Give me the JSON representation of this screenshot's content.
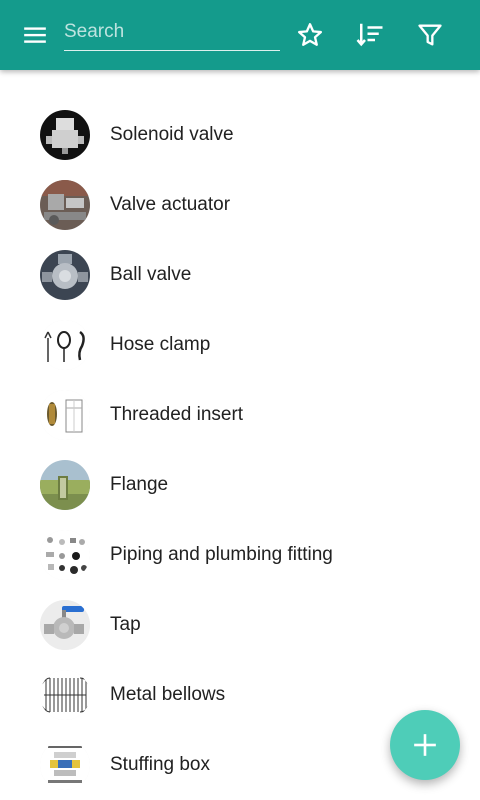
{
  "appbar": {
    "search": {
      "placeholder": "Search",
      "value": ""
    },
    "background_color": "#149b8c",
    "icons": [
      "menu-icon",
      "star-icon",
      "sort-icon",
      "filter-icon"
    ]
  },
  "items": [
    {
      "label": "Solenoid valve"
    },
    {
      "label": "Valve actuator"
    },
    {
      "label": "Ball valve"
    },
    {
      "label": "Hose clamp"
    },
    {
      "label": "Threaded insert"
    },
    {
      "label": "Flange"
    },
    {
      "label": "Piping and plumbing fitting"
    },
    {
      "label": "Tap"
    },
    {
      "label": "Metal bellows"
    },
    {
      "label": "Stuffing box"
    }
  ],
  "fab": {
    "icon": "plus-icon",
    "color": "#4ecdb8"
  }
}
